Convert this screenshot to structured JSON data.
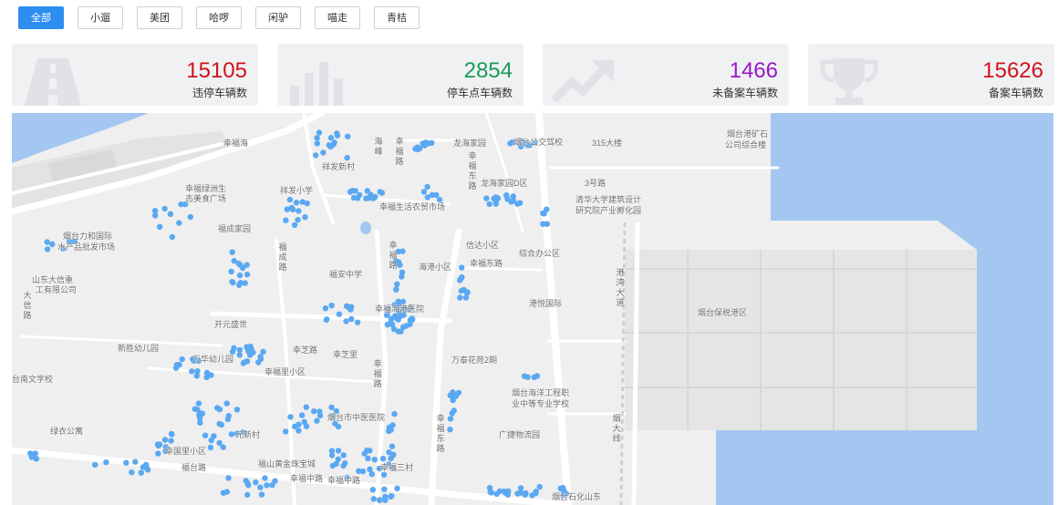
{
  "filters": [
    "全部",
    "小遛",
    "美团",
    "哈啰",
    "闲驴",
    "喵走",
    "青桔"
  ],
  "stats": [
    {
      "value": "15105",
      "label": "违停车辆数",
      "color": "#d0121b",
      "icon": "road-icon"
    },
    {
      "value": "2854",
      "label": "停车点车辆数",
      "color": "#1a9b57",
      "icon": "bar-chart-icon"
    },
    {
      "value": "1466",
      "label": "未备案车辆数",
      "color": "#9b17c9",
      "icon": "trend-up-icon"
    },
    {
      "value": "15626",
      "label": "备案车辆数",
      "color": "#d0121b",
      "icon": "trophy-icon"
    }
  ],
  "map": {
    "labels": [
      {
        "text": "幸福海"
      },
      {
        "text": "祥发新村"
      },
      {
        "text": "幸福绿洲生"
      },
      {
        "text": "态美食广场"
      },
      {
        "text": "福成家园"
      },
      {
        "text": "烟台力和国际"
      },
      {
        "text": "水产品批发市场"
      },
      {
        "text": "山东大信重"
      },
      {
        "text": "工有限公司"
      },
      {
        "text": "福安中学"
      },
      {
        "text": "幸福生活农贸市场"
      },
      {
        "text": "海港小区"
      },
      {
        "text": "信达小区"
      },
      {
        "text": "幸福东路"
      },
      {
        "text": "综合办公区"
      },
      {
        "text": "港悦国际"
      },
      {
        "text": "开元盛世"
      },
      {
        "text": "新胜幼儿园"
      },
      {
        "text": "万华幼儿园"
      },
      {
        "text": "幸福海港医院"
      },
      {
        "text": "幸芝路"
      },
      {
        "text": "幸芝里"
      },
      {
        "text": "幸福里小区"
      },
      {
        "text": "万泰花苑2期"
      },
      {
        "text": "烟台海洋工程职"
      },
      {
        "text": "业中等专业学校"
      },
      {
        "text": "烟台市中医医院"
      },
      {
        "text": "广捷物流园"
      },
      {
        "text": "绿衣公寓"
      },
      {
        "text": "幸国里小区"
      },
      {
        "text": "元新村"
      },
      {
        "text": "福山黄金珠宝城"
      },
      {
        "text": "幸福中路"
      },
      {
        "text": "幸福三村"
      },
      {
        "text": "烟台公交驾校"
      },
      {
        "text": "315大楼"
      },
      {
        "text": "3号路"
      },
      {
        "text": "清华大学建筑设计"
      },
      {
        "text": "研究院产业孵化园"
      },
      {
        "text": "烟台港矿石"
      },
      {
        "text": "公司综合楼"
      },
      {
        "text": "龙海家园"
      },
      {
        "text": "龙海家园D区"
      },
      {
        "text": "祥发小学"
      },
      {
        "text": "烟台保税港区"
      },
      {
        "text": "台南文学校"
      },
      {
        "text": "福成路"
      },
      {
        "text": "海峰"
      },
      {
        "text": "幸福路"
      },
      {
        "text": "幸福东路"
      },
      {
        "text": "幸福路"
      },
      {
        "text": "港湾大道"
      },
      {
        "text": "大信路"
      },
      {
        "text": "烟台石化山东"
      },
      {
        "text": "福台路"
      },
      {
        "text": "幸福中路"
      },
      {
        "text": "烟大线"
      },
      {
        "text": "幸福路"
      },
      {
        "text": "幸福东路"
      }
    ]
  }
}
